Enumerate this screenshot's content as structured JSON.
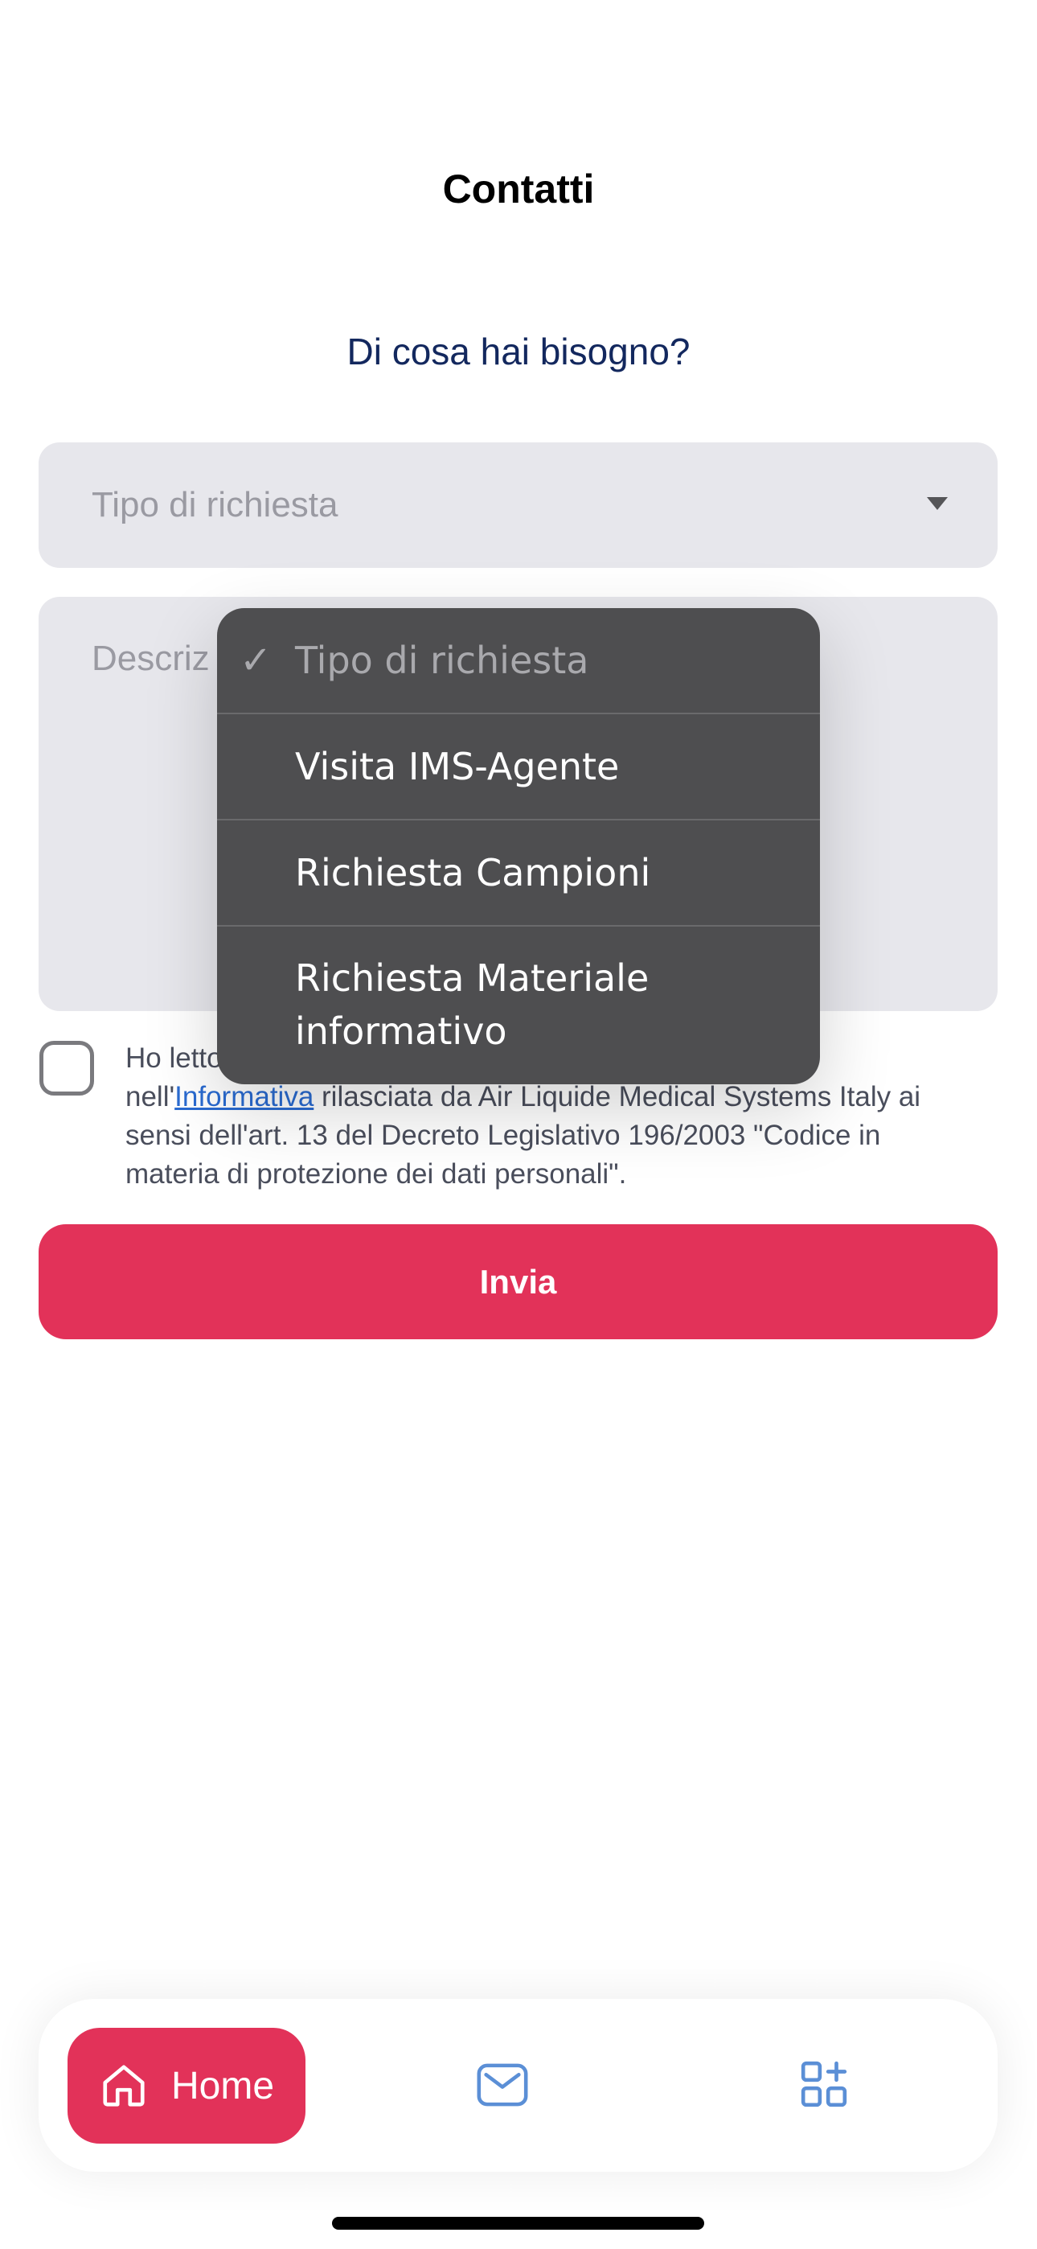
{
  "header": {
    "title": "Contatti"
  },
  "form": {
    "subtitle": "Di cosa hai bisogno?",
    "request_type": {
      "placeholder": "Tipo di richiesta"
    },
    "description": {
      "placeholder": "Descriz"
    },
    "consent": {
      "text_before": "Ho letto",
      "text_line2_prefix": "nell'",
      "link_label": "Informativa",
      "text_after": " rilasciata da Air Liquide Medical Systems Italy ai sensi dell'art. 13 del Decreto Legislativo 196/2003 \"Codice in materia di protezione dei dati personali\".",
      "checked": false
    },
    "submit_label": "Invia"
  },
  "dropdown": {
    "selected_index": 0,
    "check_glyph": "✓",
    "options": [
      {
        "label": "Tipo di richiesta"
      },
      {
        "label": "Visita IMS-Agente"
      },
      {
        "label": "Richiesta Campioni"
      },
      {
        "label": "Richiesta Materiale informativo"
      }
    ]
  },
  "bottom_nav": {
    "home_label": "Home",
    "home_icon": "home-icon",
    "mail_icon": "mail-icon",
    "apps_icon": "apps-add-icon"
  },
  "colors": {
    "accent": "#e23259",
    "nav_icon": "#5b8fd6",
    "subtitle": "#13285e"
  }
}
